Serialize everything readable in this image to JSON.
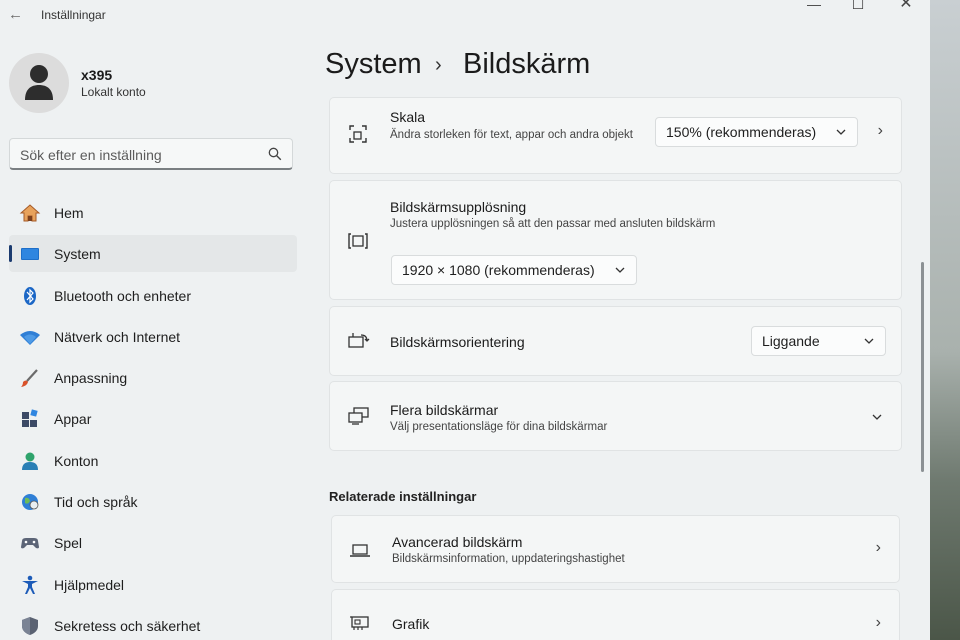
{
  "titlebar": {
    "app_title": "Inställningar",
    "back_icon": "back-arrow-icon",
    "minimize_glyph": "—",
    "maximize_glyph": "☐",
    "close_glyph": "✕"
  },
  "profile": {
    "name": "x395",
    "account_type": "Lokalt konto"
  },
  "search": {
    "placeholder": "Sök efter en inställning"
  },
  "nav": {
    "items": [
      {
        "label": "Hem",
        "icon": "home-icon",
        "active": false
      },
      {
        "label": "System",
        "icon": "system-icon",
        "active": true
      },
      {
        "label": "Bluetooth och enheter",
        "icon": "bluetooth-icon",
        "active": false
      },
      {
        "label": "Nätverk och Internet",
        "icon": "wifi-icon",
        "active": false
      },
      {
        "label": "Anpassning",
        "icon": "brush-icon",
        "active": false
      },
      {
        "label": "Appar",
        "icon": "apps-icon",
        "active": false
      },
      {
        "label": "Konton",
        "icon": "account-icon",
        "active": false
      },
      {
        "label": "Tid och språk",
        "icon": "globe-icon",
        "active": false
      },
      {
        "label": "Spel",
        "icon": "gamepad-icon",
        "active": false
      },
      {
        "label": "Hjälpmedel",
        "icon": "accessibility-icon",
        "active": false
      },
      {
        "label": "Sekretess och säkerhet",
        "icon": "shield-icon",
        "active": false
      }
    ]
  },
  "header": {
    "parent": "System",
    "separator": "›",
    "current": "Bildskärm"
  },
  "cards": {
    "scale": {
      "title": "Skala",
      "desc": "Ändra storleken för text, appar och andra objekt",
      "value": "150% (rekommenderas)"
    },
    "resolution": {
      "title": "Bildskärmsupplösning",
      "desc": "Justera  upplösningen så att den passar med  ansluten bildskärm",
      "value": "1920 × 1080 (rekommenderas)"
    },
    "orientation": {
      "title": "Bildskärmsorientering",
      "value": "Liggande"
    },
    "multiple": {
      "title": "Flera bildskärmar",
      "desc": "Välj presentationsläge för dina bildskärmar"
    }
  },
  "related": {
    "heading": "Relaterade inställningar",
    "advanced": {
      "title": "Avancerad bildskärm",
      "desc": "Bildskärmsinformation, uppdateringshastighet"
    },
    "graphics": {
      "title": "Grafik"
    }
  },
  "colors": {
    "accent": "#1b3b6f",
    "window_bg": "#eef1f2",
    "card_bg": "#f4f6f6"
  }
}
